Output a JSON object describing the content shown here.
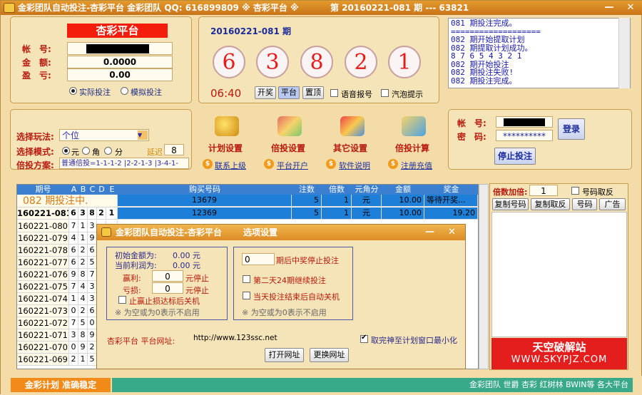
{
  "title": {
    "left": "金彩团队自动投注-杏彩平台 金彩团队 QQ: 616899809 ※ 杏彩平台 ※",
    "right": "第 20160221-081 期  ---  63821"
  },
  "account": {
    "platform": "杏彩平台",
    "account_label": "帐　号:",
    "amount_label": "金　额:",
    "amount_value": "0.0000",
    "profit_label": "盈　亏:",
    "profit_value": "0.00",
    "radio_real": "实际投注",
    "radio_sim": "模拟投注"
  },
  "draw": {
    "period": "20160221-081 期",
    "balls": [
      "6",
      "3",
      "8",
      "2",
      "1"
    ],
    "timer": "06:40",
    "btn_open": "开奖",
    "btn_platform": "平台",
    "btn_top": "置顶",
    "voice": "语音报号",
    "bubble": "汽泡提示"
  },
  "log": {
    "lines": [
      "081 期投注完成。",
      "===================",
      "082 期开始提取计划",
      "082 期提取计划成功。",
      "8 7 6 5 4 3 2 1",
      "082 期开始投注",
      "082 期投注失败!",
      "082 期投注完成。",
      "==================="
    ]
  },
  "settings": {
    "play_label": "选择玩法:",
    "play_value": "个位",
    "mode_label": "选择模式:",
    "mode_yuan": "元",
    "mode_jiao": "角",
    "mode_fen": "分",
    "delay_label": "延迟",
    "delay_value": "8",
    "plan_label": "倍投方案:",
    "plan_value": "普通倍投=1-1-1-2 |2-2-1-3 |3-4-1-"
  },
  "tools": {
    "t1": "计划设置",
    "t2": "倍投设置",
    "t3": "其它设置",
    "t4": "倍投计算",
    "l1": "联系上级",
    "l2": "平台开户",
    "l3": "软件说明",
    "l4": "注册充值"
  },
  "login": {
    "account_label": "帐　号:",
    "password_label": "密　码:",
    "password_value": "**********",
    "login_btn": "登录",
    "stop_btn": "停止投注"
  },
  "table": {
    "headers": [
      "期号",
      "A",
      "B",
      "C",
      "D",
      "E",
      "购买号码",
      "注数",
      "倍数",
      "元角分",
      "金额",
      "奖金"
    ],
    "status_text": "082 期投注中.",
    "current_period": "160221-081",
    "current_digits": [
      "6",
      "3",
      "8",
      "2",
      "1"
    ],
    "rows": [
      {
        "number": "13679",
        "count": "5",
        "mult": "1",
        "unit": "元",
        "amount": "10.00",
        "prize": "等待开奖..."
      },
      {
        "number": "12369",
        "count": "5",
        "mult": "1",
        "unit": "元",
        "amount": "10.00",
        "prize": "19.20"
      }
    ],
    "history": [
      {
        "p": "160221-080",
        "d": [
          "7",
          "1",
          "3",
          "",
          ""
        ]
      },
      {
        "p": "160221-079",
        "d": [
          "4",
          "1",
          "9",
          "",
          ""
        ]
      },
      {
        "p": "160221-078",
        "d": [
          "6",
          "2",
          "6",
          "",
          ""
        ]
      },
      {
        "p": "160221-077",
        "d": [
          "6",
          "2",
          "5",
          "",
          ""
        ]
      },
      {
        "p": "160221-076",
        "d": [
          "9",
          "8",
          "7",
          "",
          ""
        ]
      },
      {
        "p": "160221-075",
        "d": [
          "7",
          "4",
          "3",
          "",
          ""
        ]
      },
      {
        "p": "160221-074",
        "d": [
          "1",
          "4",
          "3",
          "",
          ""
        ]
      },
      {
        "p": "160221-073",
        "d": [
          "0",
          "2",
          "6",
          "",
          ""
        ]
      },
      {
        "p": "160221-072",
        "d": [
          "7",
          "5",
          "0",
          "",
          ""
        ]
      },
      {
        "p": "160221-071",
        "d": [
          "3",
          "8",
          "9",
          "",
          ""
        ]
      },
      {
        "p": "160221-070",
        "d": [
          "0",
          "9",
          "2",
          "",
          ""
        ]
      },
      {
        "p": "160221-069",
        "d": [
          "2",
          "1",
          "5",
          "",
          ""
        ]
      }
    ]
  },
  "dialog": {
    "title": "金彩团队自动投注-杏彩平台",
    "menu": "选项设置",
    "init_label": "初始金额为:",
    "init_value": "0.00 元",
    "cur_label": "当前利润为:",
    "cur_value": "0.00 元",
    "win_label": "赢利:",
    "win_value": "0",
    "win_unit": "元停止",
    "loss_label": "亏损:",
    "loss_value": "0",
    "loss_unit": "元停止",
    "shutdown_label": "止赢止损达标后关机",
    "note1": "※ 为空或为0表示不启用",
    "stop_prefix": "0",
    "stop_label": "期后中奖停止投注",
    "cont24": "第二天24期继续投注",
    "autoshut": "当天投注结束后自动关机",
    "note2": "※ 为空或为0表示不启用",
    "url_label": "杏彩平台 平台网址:",
    "url_value": "http://www.123ssc.net",
    "open_btn": "打开网址",
    "change_btn": "更换网址",
    "minimize_label": "取完神至计划窗口最小化"
  },
  "right": {
    "mult_label": "倍数加倍:",
    "mult_value": "1",
    "take_label": "号码取反",
    "btn_copy": "复制号码",
    "btn_copy_rev": "复制取反",
    "btn_num": "号码",
    "btn_ad": "广告",
    "ad_title": "天空破解站",
    "ad_url": "WWW.SKYPJZ.COM"
  },
  "status": {
    "left": "金彩计划 准确稳定",
    "right": "金彩团队 世爵 杏彩 红树林 BWIN等 各大平台"
  }
}
